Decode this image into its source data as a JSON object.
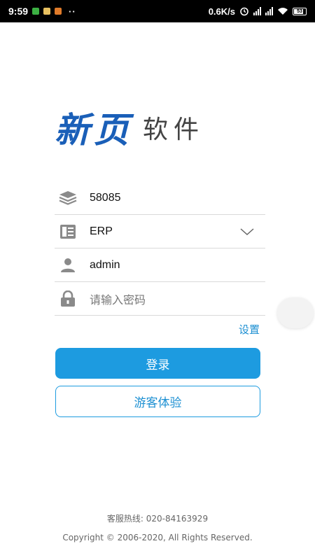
{
  "status_bar": {
    "time": "9:59",
    "dots": "··",
    "net_speed": "0.6K/s",
    "battery": "53"
  },
  "logo": {
    "main": "新页",
    "sub": "软件",
    "brand_color": "#1a5fb8"
  },
  "form": {
    "account_set": {
      "value": "58085",
      "icon": "layers-icon"
    },
    "system": {
      "value": "ERP",
      "icon": "server-icon"
    },
    "username": {
      "value": "admin",
      "icon": "user-icon"
    },
    "password": {
      "value": "",
      "placeholder": "请输入密码",
      "icon": "lock-icon"
    }
  },
  "settings_label": "设置",
  "buttons": {
    "login": "登录",
    "guest": "游客体验",
    "accent": "#1d9be0"
  },
  "footer": {
    "hotline": "客服热线: 020-84163929",
    "copyright": "Copyright © 2006-2020, All Rights Reserved."
  }
}
